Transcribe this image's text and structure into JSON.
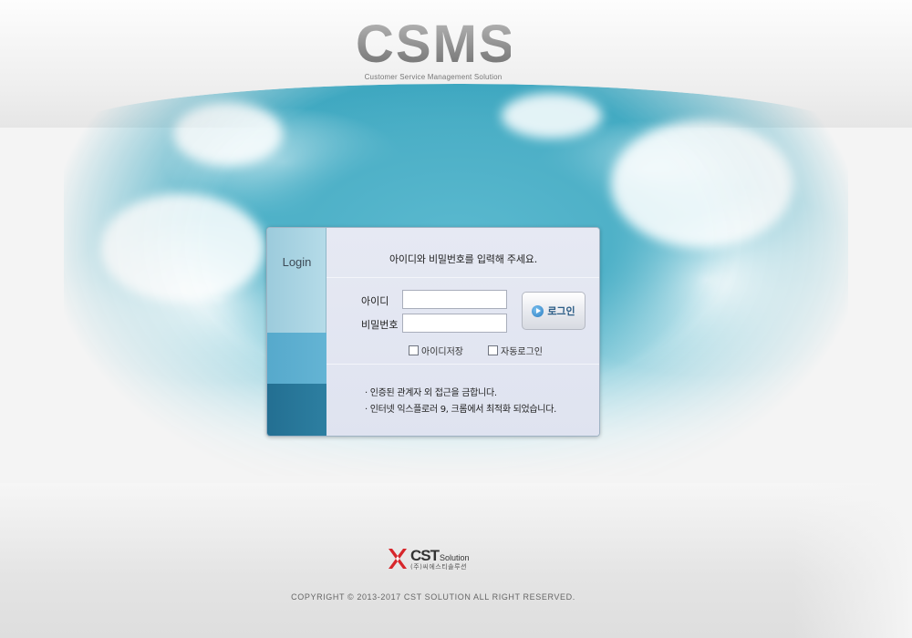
{
  "brand": {
    "title": "CSMS",
    "subtitle": "Customer Service Management Solution"
  },
  "login_panel": {
    "side_label": "Login",
    "instruction": "아이디와 비밀번호를 입력해 주세요.",
    "id_label": "아이디",
    "password_label": "비밀번호",
    "id_value": "",
    "password_value": "",
    "login_button_label": "로그인",
    "login_button_icon": "play-circle-icon",
    "save_id_label": "아이디저장",
    "auto_login_label": "자동로그인",
    "save_id_checked": false,
    "auto_login_checked": false,
    "notices": [
      "· 인증된 관계자 외 접근을 금합니다.",
      "· 인터넷 익스플로러 9, 크롬에서 최적화 되었습니다."
    ]
  },
  "footer": {
    "logo_main": "CST",
    "logo_suffix": "Solution",
    "logo_korean": "(주)씨에스티솔루션",
    "copyright": "COPYRIGHT © 2013-2017 CST SOLUTION ALL RIGHT RESERVED."
  },
  "colors": {
    "sky": "#4fb1c8",
    "side_top": "#a9d3e3",
    "side_mid": "#5aadcf",
    "side_bottom": "#2a789a",
    "panel_bg": "#dfe3f0",
    "button_text": "#2c5d86",
    "logo_red": "#d7262b"
  }
}
